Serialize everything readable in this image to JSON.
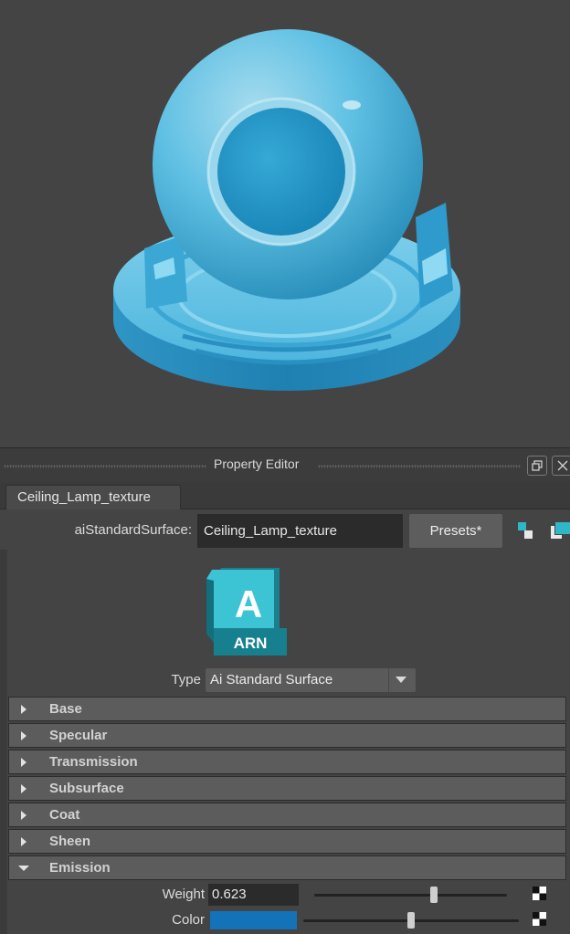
{
  "panel": {
    "title": "Property Editor"
  },
  "tab": {
    "label": "Ceiling_Lamp_texture"
  },
  "node": {
    "type_label": "aiStandardSurface:",
    "name_value": "Ceiling_Lamp_texture",
    "presets_label": "Presets*"
  },
  "logo": {
    "letter": "A",
    "text": "ARN"
  },
  "shader_type": {
    "label": "Type",
    "value": "Ai Standard Surface"
  },
  "sections": [
    {
      "label": "Base",
      "expanded": false
    },
    {
      "label": "Specular",
      "expanded": false
    },
    {
      "label": "Transmission",
      "expanded": false
    },
    {
      "label": "Subsurface",
      "expanded": false
    },
    {
      "label": "Coat",
      "expanded": false
    },
    {
      "label": "Sheen",
      "expanded": false
    },
    {
      "label": "Emission",
      "expanded": true
    }
  ],
  "emission": {
    "weight_label": "Weight",
    "weight_value": "0.623",
    "weight_level": 0.623,
    "color_label": "Color",
    "color_hex": "#1472b8",
    "color_level": 0.5
  },
  "colors": {
    "accent": "#2fb7c9",
    "material": "#5fc2e6",
    "emission_color": "#1472b8"
  },
  "icons": {
    "title_float": "float-window-icon",
    "title_close": "close-icon",
    "node_input": "input-connections-icon",
    "node_output": "output-connections-icon",
    "map_button": "checker-map-icon"
  }
}
